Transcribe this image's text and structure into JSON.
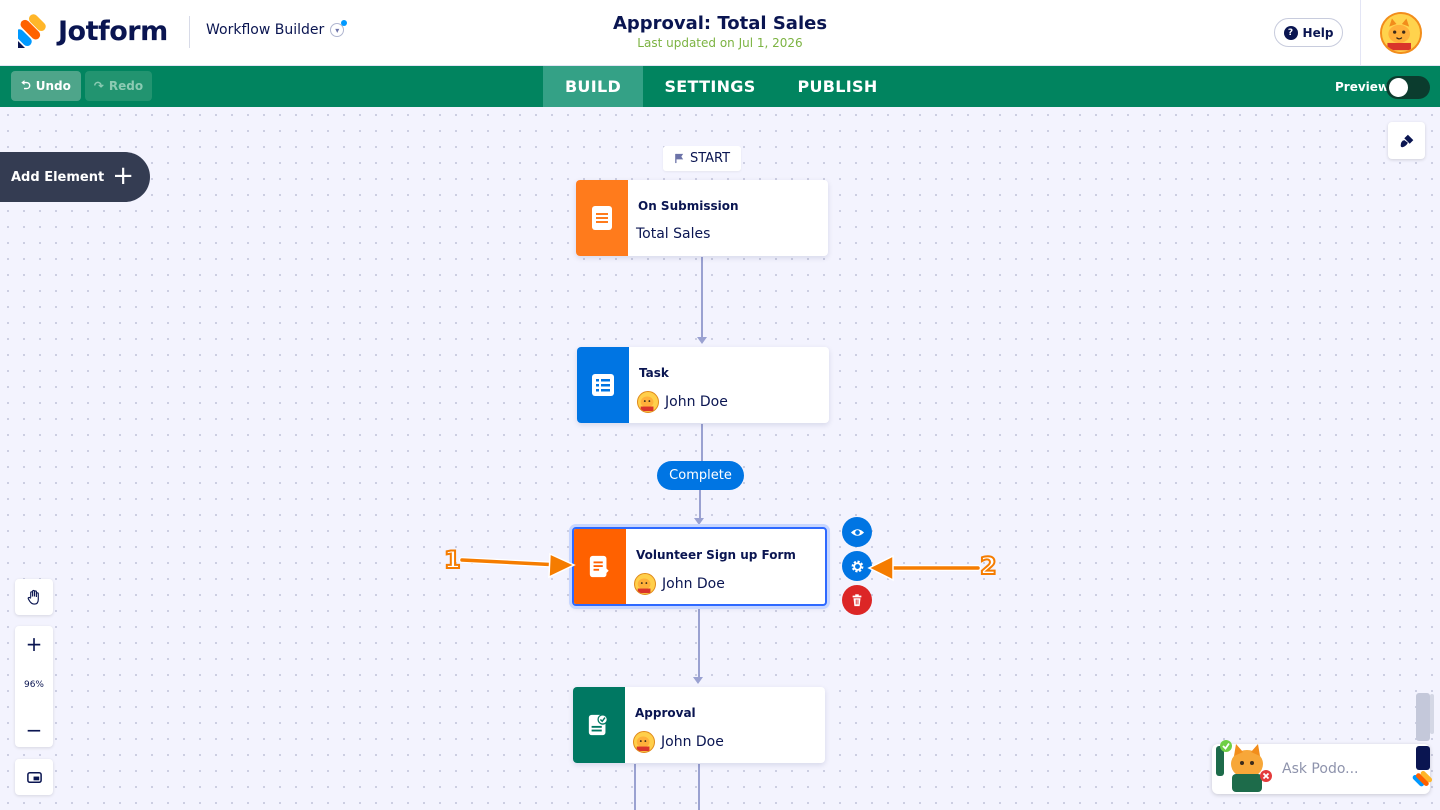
{
  "header": {
    "brand": "Jotform",
    "app_name": "Workflow Builder",
    "title": "Approval: Total Sales",
    "updated": "Last updated on Jul 1, 2026",
    "help_label": "Help"
  },
  "toolbar": {
    "undo_label": "Undo",
    "redo_label": "Redo",
    "tabs": [
      "BUILD",
      "SETTINGS",
      "PUBLISH"
    ],
    "active_tab": "BUILD",
    "preview_label": "Preview",
    "preview_on": false
  },
  "canvas": {
    "add_element_label": "Add Element",
    "start_label": "START",
    "nodes": [
      {
        "title": "On Submission",
        "subtitle": "Total Sales",
        "color": "#ff7b1c",
        "icon": "form-icon"
      },
      {
        "title": "Task",
        "subtitle": "John Doe",
        "color": "#0075e3",
        "icon": "task-list-icon"
      },
      {
        "title": "Volunteer Sign up Form",
        "subtitle": "John Doe",
        "color": "#ff6100",
        "icon": "form-assign-icon"
      },
      {
        "title": "Approval",
        "subtitle": "John Doe",
        "color": "#007862",
        "icon": "approval-icon"
      }
    ],
    "complete_label": "Complete",
    "annotations": [
      "1",
      "2"
    ],
    "zoom_level": "96%"
  },
  "podo": {
    "placeholder": "Ask Podo..."
  },
  "colors": {
    "toolbar": "#01845f",
    "accent_blue": "#0075e3",
    "delete_red": "#dc2626",
    "annotation_orange": "#f57c00"
  }
}
